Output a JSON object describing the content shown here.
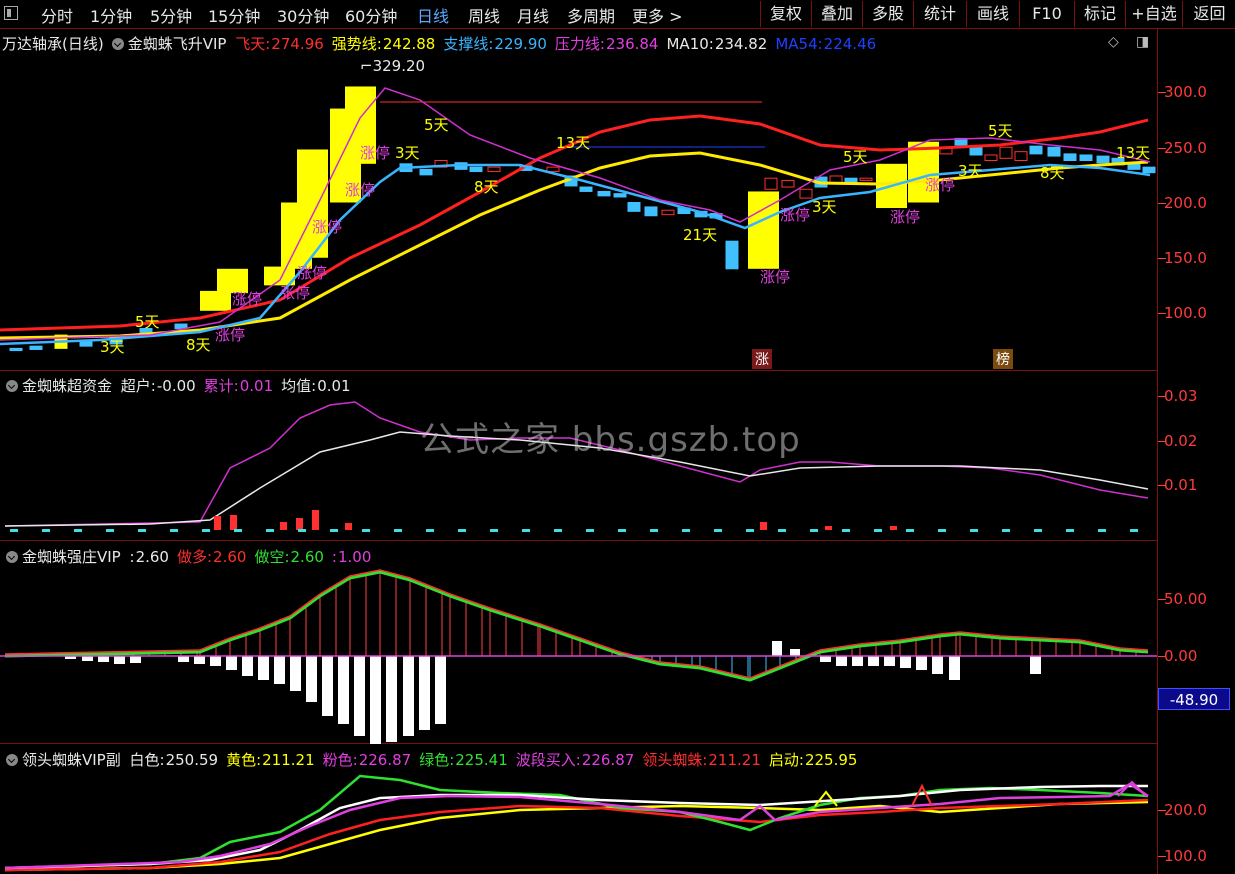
{
  "toolbar": {
    "periods": [
      "分时",
      "1分钟",
      "5分钟",
      "15分钟",
      "30分钟",
      "60分钟",
      "日线",
      "周线",
      "月线",
      "多周期",
      "更多 >"
    ],
    "active_period": "日线",
    "right_buttons": [
      "复权",
      "叠加",
      "多股",
      "统计",
      "画线",
      "F10",
      "标记",
      "+自选",
      "返回"
    ]
  },
  "main": {
    "stock": "万达轴承(日线)",
    "indicator": "金蜘蛛飞升VIP",
    "fields": [
      {
        "label": "飞天:",
        "value": "274.96",
        "color": "#ff3030"
      },
      {
        "label": "强势线:",
        "value": "242.88",
        "color": "#ffff00"
      },
      {
        "label": "支撑线:",
        "value": "229.90",
        "color": "#3ab4ff"
      },
      {
        "label": "压力线:",
        "value": "236.84",
        "color": "#e040e0"
      },
      {
        "label": "MA10:",
        "value": "234.82",
        "color": "#e8e8e8"
      },
      {
        "label": "MA54:",
        "value": "224.46",
        "color": "#2040ff"
      }
    ],
    "peak_label": "329.20",
    "axis": [
      "300.0",
      "250.0",
      "200.0",
      "150.0",
      "100.0"
    ],
    "tags": [
      "涨",
      "榜"
    ]
  },
  "panel2": {
    "indicator": "金蜘蛛超资金",
    "fields": [
      {
        "label": "超户:",
        "value": "-0.00",
        "color": "#e8e8e8"
      },
      {
        "label": "累计:",
        "value": "0.01",
        "color": "#e040e0"
      },
      {
        "label": "均值:",
        "value": "0.01",
        "color": "#e8e8e8"
      }
    ],
    "axis": [
      "0.03",
      "0.02",
      "0.01"
    ]
  },
  "panel3": {
    "indicator": "金蜘蛛强庄VIP",
    "fields": [
      {
        "label": ":",
        "value": "2.60",
        "color": "#e8e8e8"
      },
      {
        "label": "做多:",
        "value": "2.60",
        "color": "#ff3030"
      },
      {
        "label": "做空:",
        "value": "2.60",
        "color": "#30e030"
      },
      {
        "label": ":",
        "value": "1.00",
        "color": "#e040e0"
      }
    ],
    "axis": [
      "50.00",
      "0.00"
    ],
    "cursor_value": "-48.90"
  },
  "panel4": {
    "indicator": "领头蜘蛛VIP副",
    "fields": [
      {
        "label": "白色:",
        "value": "250.59",
        "color": "#e8e8e8"
      },
      {
        "label": "黄色:",
        "value": "211.21",
        "color": "#ffff00"
      },
      {
        "label": "粉色:",
        "value": "226.87",
        "color": "#e040e0"
      },
      {
        "label": "绿色:",
        "value": "225.41",
        "color": "#30e030"
      },
      {
        "label": "波段买入:",
        "value": "226.87",
        "color": "#e040e0"
      },
      {
        "label": "领头蜘蛛:",
        "value": "211.21",
        "color": "#ff3030"
      },
      {
        "label": "启动:",
        "value": "225.95",
        "color": "#ffff00"
      }
    ],
    "axis": [
      "200.0",
      "100.0"
    ]
  },
  "watermark": "公式之家 bbs.gszb.top",
  "annotations": [
    "5天",
    "3天",
    "8天",
    "13天",
    "21天",
    "涨停"
  ]
}
